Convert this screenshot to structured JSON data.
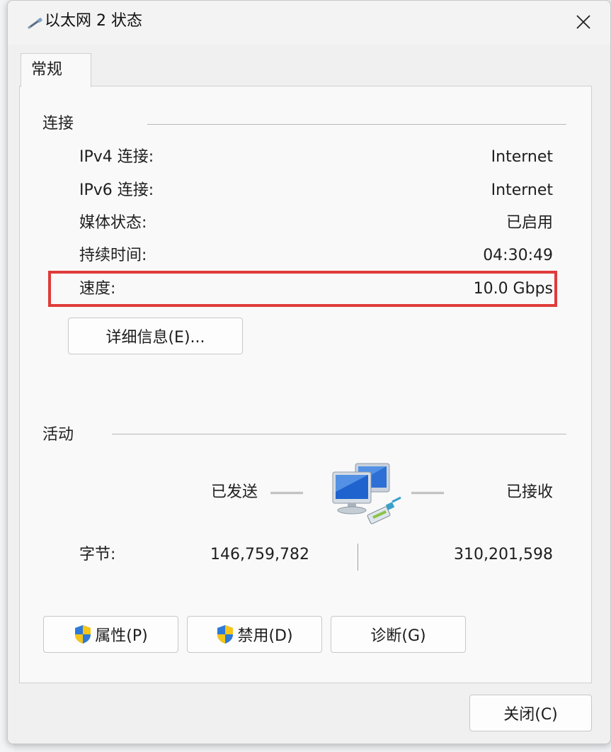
{
  "window": {
    "title": "以太网 2 状态",
    "icon": "ethernet-cable-icon",
    "close_icon": "close-icon"
  },
  "tabs": [
    {
      "label": "常规",
      "active": true
    }
  ],
  "connection": {
    "section_title": "连接",
    "rows": [
      {
        "label": "IPv4 连接:",
        "value": "Internet"
      },
      {
        "label": "IPv6 连接:",
        "value": "Internet"
      },
      {
        "label": "媒体状态:",
        "value": "已启用"
      },
      {
        "label": "持续时间:",
        "value": "04:30:49"
      },
      {
        "label": "速度:",
        "value": "10.0 Gbps"
      }
    ],
    "details_button": "详细信息(E)..."
  },
  "activity": {
    "section_title": "活动",
    "sent_label": "已发送",
    "received_label": "已接收",
    "bytes_label": "字节:",
    "bytes_sent": "146,759,782",
    "bytes_received": "310,201,598",
    "icon": "network-computers-icon"
  },
  "buttons": {
    "properties": "属性(P)",
    "disable": "禁用(D)",
    "diagnose": "诊断(G)",
    "close": "关闭(C)",
    "shield_icon": "uac-shield-icon"
  },
  "colors": {
    "highlight": "#e03b3b",
    "dialog_bg": "#f0f0f0",
    "panel_bg": "#f9f9f9"
  }
}
